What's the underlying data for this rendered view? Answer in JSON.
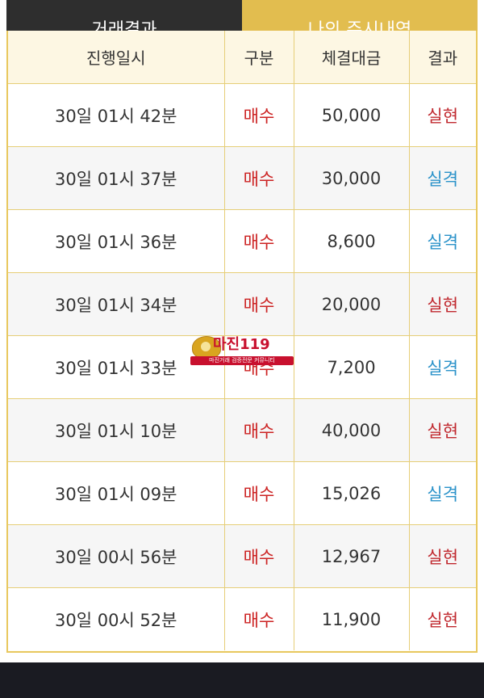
{
  "tabs": {
    "left_label": "거래결과",
    "right_label": "나의 주시내역"
  },
  "table": {
    "headers": [
      "진행일시",
      "구분",
      "체결대금",
      "결과"
    ],
    "rows": [
      {
        "time": "30일 01시 42분",
        "type": "매수",
        "amount": "50,000",
        "result": "실현"
      },
      {
        "time": "30일 01시 37분",
        "type": "매수",
        "amount": "30,000",
        "result": "실격"
      },
      {
        "time": "30일 01시 36분",
        "type": "매수",
        "amount": "8,600",
        "result": "실격"
      },
      {
        "time": "30일 01시 34분",
        "type": "매수",
        "amount": "20,000",
        "result": "실현"
      },
      {
        "time": "30일 01시 33분",
        "type": "매수",
        "amount": "7,200",
        "result": "실격"
      },
      {
        "time": "30일 01시 10분",
        "type": "매수",
        "amount": "40,000",
        "result": "실현"
      },
      {
        "time": "30일 01시 09분",
        "type": "매수",
        "amount": "15,026",
        "result": "실격"
      },
      {
        "time": "30일 00시 56분",
        "type": "매수",
        "amount": "12,967",
        "result": "실현"
      },
      {
        "time": "30일 00시 52분",
        "type": "매수",
        "amount": "11,900",
        "result": "실현"
      }
    ]
  },
  "watermark": {
    "title": "마진119",
    "subtitle": "마진거래 검증전문 커뮤니티"
  },
  "colors": {
    "accent_gold": "#e2bd4f",
    "type_red": "#cc2222",
    "result_realized": "#c0282e",
    "result_failed": "#2a92c9"
  }
}
